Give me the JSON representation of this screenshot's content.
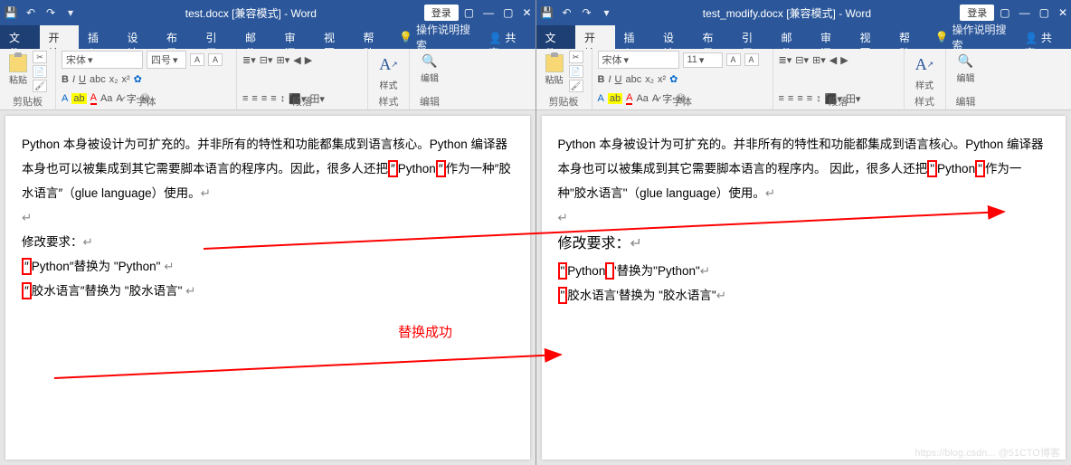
{
  "left": {
    "title": "test.docx [兼容模式] - Word",
    "login": "登录",
    "tabs": {
      "file": "文件",
      "start": "开始",
      "insert": "插入",
      "design": "设计",
      "layout": "布局",
      "ref": "引用",
      "mail": "邮件",
      "review": "审阅",
      "view": "视图",
      "help": "帮助",
      "search": "操作说明搜索",
      "share": "共享"
    },
    "ribbon": {
      "paste": "粘贴",
      "clipboard": "剪贴板",
      "font_name": "宋体",
      "font_size": "四号",
      "font_group": "字体",
      "para_group": "段落",
      "style_group": "样式",
      "style_label": "样式",
      "edit_group": "编辑",
      "edit_label": "编辑"
    },
    "doc": {
      "p1_a": "Python 本身被设计为可扩充的。并非所有的特性和功能都集成到语言核心。Python 编译器本身也可以被集成到其它需要脚本语言的程序内。因此，很多人还把",
      "p1_q1": "″",
      "p1_py": "Python",
      "p1_q2": "″",
      "p1_b": "作为一种″胶水语言″（glue language）使用。",
      "h2": "修改要求：",
      "l1_a": "″",
      "l1_b": "Python″替换为 \"Python\" ",
      "l2_a": "″",
      "l2_b": "胶水语言″替换为  \"胶水语言\" "
    }
  },
  "right": {
    "title": "test_modify.docx [兼容模式] - Word",
    "login": "登录",
    "tabs": {
      "file": "文件",
      "start": "开始",
      "insert": "插入",
      "design": "设计",
      "layout": "布局",
      "ref": "引用",
      "mail": "邮件",
      "review": "审阅",
      "view": "视图",
      "help": "帮助",
      "search": "操作说明搜索",
      "share": "共享"
    },
    "ribbon": {
      "paste": "粘贴",
      "clipboard": "剪贴板",
      "font_name": "宋体",
      "font_size": "11",
      "font_group": "字体",
      "para_group": "段落",
      "style_group": "样式",
      "style_label": "样式",
      "edit_group": "编辑",
      "edit_label": "编辑"
    },
    "doc": {
      "p1_a": "Python 本身被设计为可扩充的。并非所有的特性和功能都集成到语言核心。Python 编译器本身也可以被集成到其它需要脚本语言的程序内。 因此，很多人还把",
      "p1_q1": "\"",
      "p1_py": "Python",
      "p1_q2": "\"",
      "p1_b": "作为一种\"胶水语言\"（glue language）使用。",
      "h2": "修改要求：",
      "l1_a": "\"",
      "l1_py": "Python",
      "l1_b": "'替换为\"Python\"",
      "l2_a": "\"",
      "l2_b": "胶水语言'替换为 \"胶水语言\""
    }
  },
  "annotation": {
    "success": "替换成功"
  },
  "watermark": "https://blog.csdn... @51CTO博客"
}
